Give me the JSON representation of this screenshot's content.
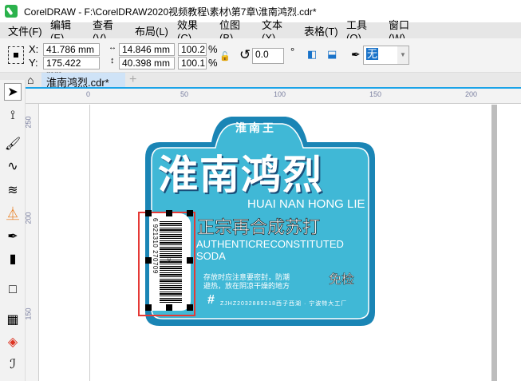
{
  "window": {
    "title": "CorelDRAW - F:\\CorelDRAW2020视频教程\\素材\\第7章\\淮南鸿烈.cdr*"
  },
  "menu": [
    "文件(F)",
    "编辑(E)",
    "查看(V)",
    "布局(L)",
    "效果(C)",
    "位图(B)",
    "文本(X)",
    "表格(T)",
    "工具(O)",
    "窗口(W)"
  ],
  "propbar": {
    "x_label": "X:",
    "y_label": "Y:",
    "x": "41.786 mm",
    "y": "175.422 mm",
    "width": "14.846 mm",
    "height": "40.398 mm",
    "scale_x": "100.2",
    "scale_y": "100.1",
    "percent": "%",
    "rotation": "0.0",
    "degree": "°",
    "outline": "无"
  },
  "tabs": {
    "document": "淮南鸿烈.cdr*",
    "add": "+"
  },
  "hruler": [
    "0",
    "50",
    "100",
    "150",
    "200"
  ],
  "vruler": [
    "250",
    "200",
    "150"
  ],
  "label": {
    "brand": "淮南王",
    "title": "淮南鸿烈",
    "pinyin": "HUAI NAN HONG LIE",
    "subtitle": "正宗再合成苏打",
    "english": "AUTHENTICRECONSTITUTED SODA",
    "notice1": "存放时应注意要密封，防潮",
    "notice2": "避热，放在阴凉干燥的地方",
    "exempt": "免检",
    "hash": "#",
    "footer": "ZJHZ2032889218西子西湖 · 宁波特大工厂",
    "barcode": "6 921310 270709"
  },
  "colors": {
    "label_blue": "#40b8d6",
    "border_blue": "#1a85b5",
    "selection_red": "#e53935",
    "accent": "#1aa3e8"
  }
}
